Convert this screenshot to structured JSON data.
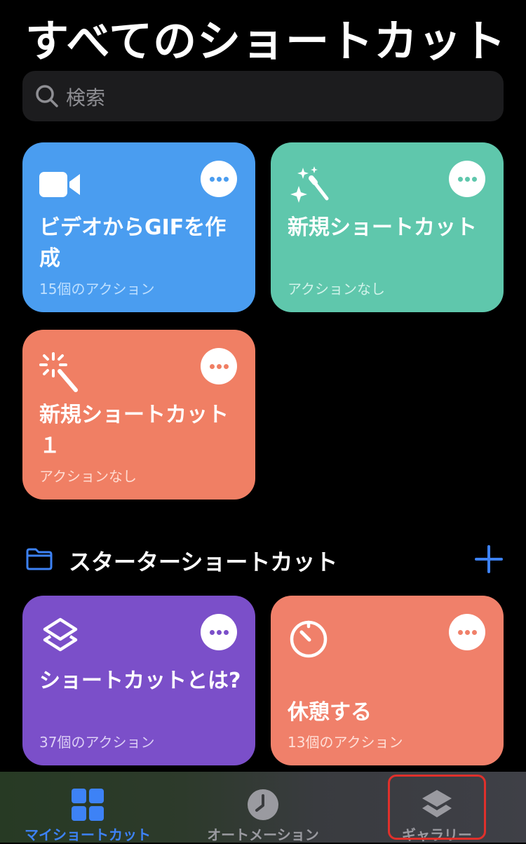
{
  "header": {
    "title": "すべてのショートカット"
  },
  "search": {
    "placeholder": "検索",
    "icon": "search-icon"
  },
  "shortcuts": [
    {
      "name": "ビデオからGIFを作成",
      "sub": "15個のアクション",
      "color": "#4a9df0",
      "subColor": "#bfe0ff",
      "icon": "video-camera-icon"
    },
    {
      "name": "新規ショートカット",
      "sub": "アクションなし",
      "color": "#5fc7ac",
      "subColor": "#d2f3ea",
      "icon": "sparkles-icon"
    },
    {
      "name": "新規ショートカット１",
      "sub": "アクションなし",
      "color": "#f07f64",
      "subColor": "#ffdcd2",
      "icon": "magic-wand-icon"
    }
  ],
  "section": {
    "title": "スターターショートカット",
    "icon": "folder-icon",
    "accent": "#3d82f6"
  },
  "starter": [
    {
      "name": "ショートカットとは?",
      "sub": "37個のアクション",
      "color": "#7b4fc9",
      "subColor": "#ddd0f5",
      "icon": "layers-icon"
    },
    {
      "name": "休憩する",
      "sub": "13個のアクション",
      "color": "#f0806a",
      "subColor": "#ffe0d8",
      "icon": "timer-icon"
    }
  ],
  "tabbar": {
    "tabs": [
      {
        "label": "マイショートカット",
        "icon": "grid-icon",
        "active": true
      },
      {
        "label": "オートメーション",
        "icon": "clock-icon",
        "active": false
      },
      {
        "label": "ギャラリー",
        "icon": "layers-icon",
        "active": false
      }
    ],
    "activeColor": "#3d82f6",
    "inactiveColor": "#9a9aa0",
    "highlight": "#e0302b"
  }
}
